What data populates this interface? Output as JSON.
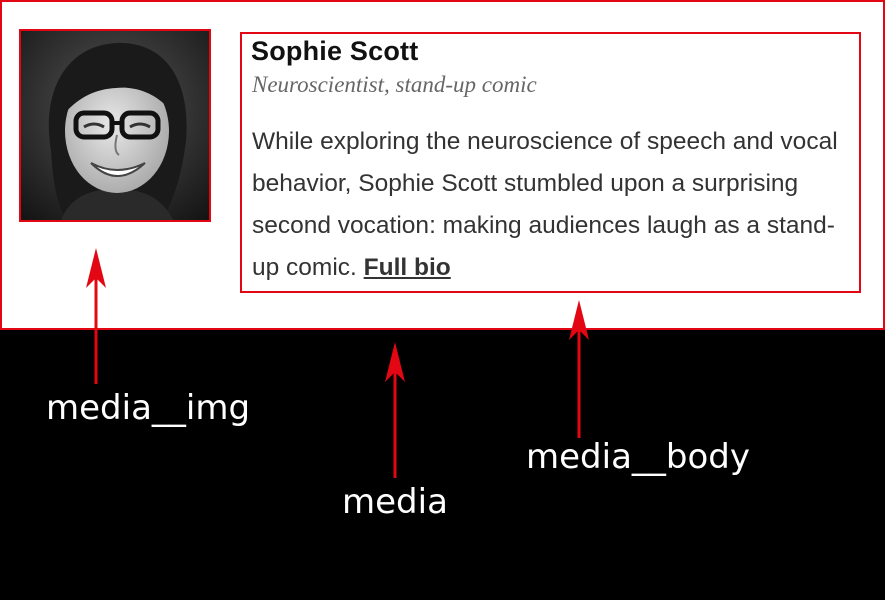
{
  "profile": {
    "name": "Sophie Scott",
    "role": "Neuroscientist, stand-up comic",
    "bio": "While exploring the neuroscience of speech and vocal behavior, Sophie Scott stumbled upon a surprising second vocation: making audiences laugh as a stand-up comic.",
    "link_label": "Full bio"
  },
  "annotations": {
    "media_img": "media__img",
    "media": "media",
    "media_body": "media__body"
  },
  "colors": {
    "annotation": "#e30613",
    "background": "#000000",
    "panel": "#ffffff"
  }
}
